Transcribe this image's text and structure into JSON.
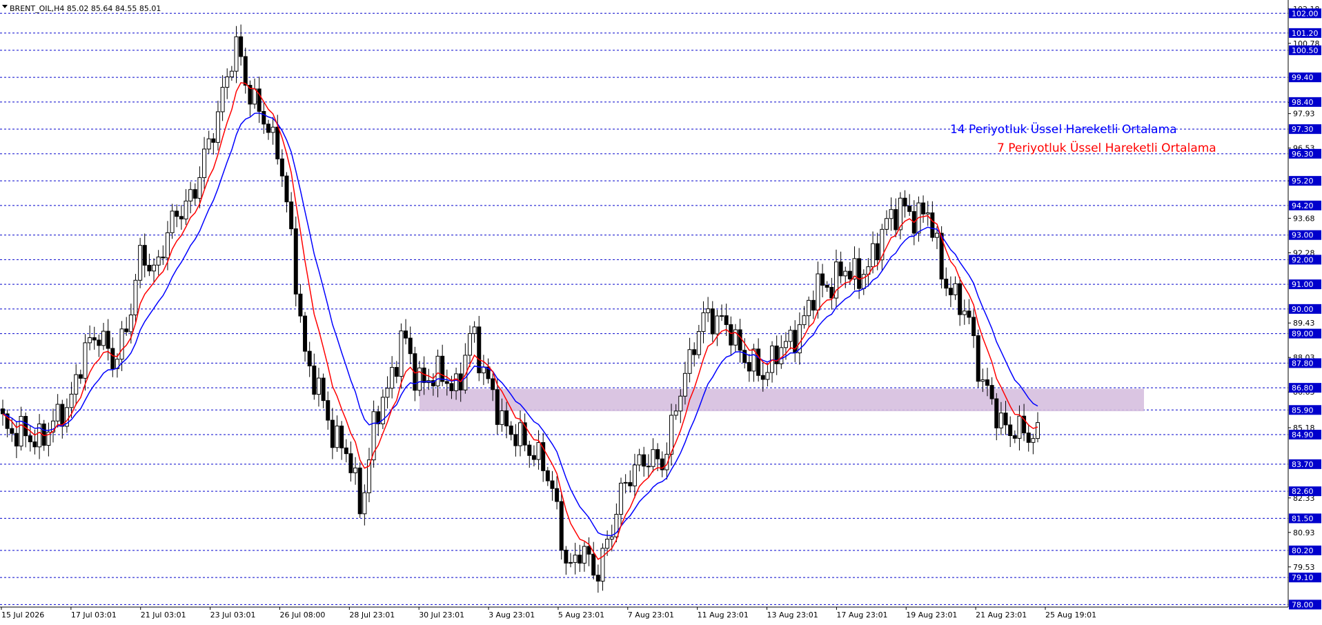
{
  "header": {
    "text": "BRENT_OIL,H4  85.02 85.64 84.55 85.01",
    "menu_icon": "triangle-down-icon"
  },
  "colors": {
    "background": "#ffffff",
    "grid": "#0000cc",
    "candle": "#000000",
    "ema14": "#0000ff",
    "ema7": "#ff0000",
    "zone": "#d6bfdf",
    "price_box": "#0000cc"
  },
  "chart_data": {
    "type": "candlestick",
    "symbol": "BRENT_OIL",
    "timeframe": "H4",
    "ylim": [
      77.9,
      102.4
    ],
    "y_axis_ticks": [
      "102.18",
      "100.78",
      "98.38",
      "97.93",
      "96.53",
      "95.20",
      "93.68",
      "92.28",
      "89.43",
      "88.03",
      "86.63",
      "85.18",
      "82.33",
      "80.93",
      "79.53"
    ],
    "level_lines": [
      "102.00",
      "101.20",
      "100.50",
      "99.40",
      "98.40",
      "97.30",
      "96.30",
      "95.20",
      "94.20",
      "93.00",
      "92.00",
      "91.00",
      "90.00",
      "89.00",
      "87.80",
      "86.80",
      "85.90",
      "84.90",
      "83.70",
      "82.60",
      "81.50",
      "80.20",
      "79.10",
      "78.00"
    ],
    "x_labels": [
      "15 Jul 2026",
      "17 Jul 03:01",
      "21 Jul 03:01",
      "23 Jul 03:01",
      "26 Jul 08:00",
      "28 Jul 23:01",
      "30 Jul 23:01",
      "3 Aug 23:01",
      "5 Aug 23:01",
      "7 Aug 23:01",
      "11 Aug 23:01",
      "13 Aug 23:01",
      "17 Aug 23:01",
      "19 Aug 23:01",
      "21 Aug 23:01",
      "25 Aug 19:01"
    ],
    "close_path": [
      85.3,
      85.0,
      84.7,
      84.9,
      85.5,
      86.5,
      88.3,
      89.2,
      87.6,
      89.4,
      92.1,
      91.6,
      93.1,
      94.2,
      94.8,
      96.9,
      98.8,
      100.8,
      98.5,
      97.6,
      96.5,
      92.3,
      87.8,
      86.5,
      84.9,
      84.0,
      82.0,
      85.5,
      87.0,
      88.9,
      87.2,
      87.1,
      87.4,
      86.6,
      89.3,
      87.2,
      85.6,
      85.0,
      84.3,
      84.1,
      82.1,
      79.4,
      80.2,
      79.3,
      80.6,
      83.1,
      83.5,
      84.1,
      83.7,
      86.7,
      88.3,
      89.9,
      89.5,
      88.8,
      87.9,
      87.2,
      88.3,
      88.5,
      89.6,
      90.8,
      91.1,
      91.5,
      91.4,
      91.8,
      93.7,
      94.0,
      93.8,
      94.0,
      91.6,
      90.4,
      89.6,
      87.0,
      85.7,
      85.1,
      84.9,
      85.0
    ]
  },
  "legend": {
    "ema14": "14 Periyotluk Üssel Hareketli Ortalama",
    "ema7": "7 Periyotluk Üssel Hareketli Ortalama"
  },
  "zone": {
    "top": 86.76,
    "bottom": 85.85
  }
}
